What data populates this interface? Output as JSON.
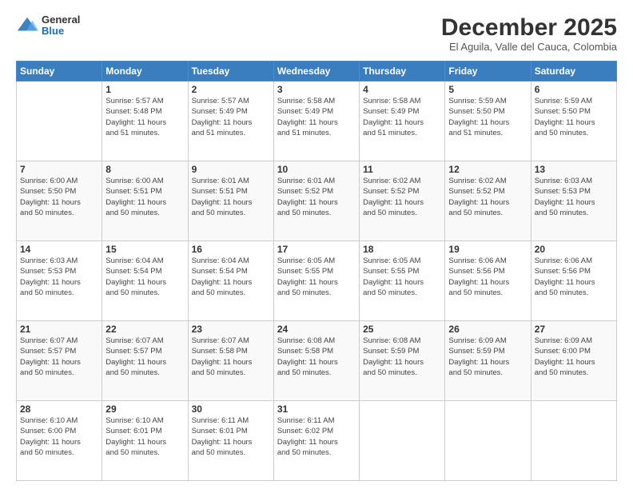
{
  "header": {
    "logo": {
      "general": "General",
      "blue": "Blue"
    },
    "title": "December 2025",
    "subtitle": "El Aguila, Valle del Cauca, Colombia"
  },
  "days_of_week": [
    "Sunday",
    "Monday",
    "Tuesday",
    "Wednesday",
    "Thursday",
    "Friday",
    "Saturday"
  ],
  "weeks": [
    [
      {
        "day": "",
        "info": ""
      },
      {
        "day": "1",
        "info": "Sunrise: 5:57 AM\nSunset: 5:48 PM\nDaylight: 11 hours\nand 51 minutes."
      },
      {
        "day": "2",
        "info": "Sunrise: 5:57 AM\nSunset: 5:49 PM\nDaylight: 11 hours\nand 51 minutes."
      },
      {
        "day": "3",
        "info": "Sunrise: 5:58 AM\nSunset: 5:49 PM\nDaylight: 11 hours\nand 51 minutes."
      },
      {
        "day": "4",
        "info": "Sunrise: 5:58 AM\nSunset: 5:49 PM\nDaylight: 11 hours\nand 51 minutes."
      },
      {
        "day": "5",
        "info": "Sunrise: 5:59 AM\nSunset: 5:50 PM\nDaylight: 11 hours\nand 51 minutes."
      },
      {
        "day": "6",
        "info": "Sunrise: 5:59 AM\nSunset: 5:50 PM\nDaylight: 11 hours\nand 50 minutes."
      }
    ],
    [
      {
        "day": "7",
        "info": "Sunrise: 6:00 AM\nSunset: 5:50 PM\nDaylight: 11 hours\nand 50 minutes."
      },
      {
        "day": "8",
        "info": "Sunrise: 6:00 AM\nSunset: 5:51 PM\nDaylight: 11 hours\nand 50 minutes."
      },
      {
        "day": "9",
        "info": "Sunrise: 6:01 AM\nSunset: 5:51 PM\nDaylight: 11 hours\nand 50 minutes."
      },
      {
        "day": "10",
        "info": "Sunrise: 6:01 AM\nSunset: 5:52 PM\nDaylight: 11 hours\nand 50 minutes."
      },
      {
        "day": "11",
        "info": "Sunrise: 6:02 AM\nSunset: 5:52 PM\nDaylight: 11 hours\nand 50 minutes."
      },
      {
        "day": "12",
        "info": "Sunrise: 6:02 AM\nSunset: 5:52 PM\nDaylight: 11 hours\nand 50 minutes."
      },
      {
        "day": "13",
        "info": "Sunrise: 6:03 AM\nSunset: 5:53 PM\nDaylight: 11 hours\nand 50 minutes."
      }
    ],
    [
      {
        "day": "14",
        "info": "Sunrise: 6:03 AM\nSunset: 5:53 PM\nDaylight: 11 hours\nand 50 minutes."
      },
      {
        "day": "15",
        "info": "Sunrise: 6:04 AM\nSunset: 5:54 PM\nDaylight: 11 hours\nand 50 minutes."
      },
      {
        "day": "16",
        "info": "Sunrise: 6:04 AM\nSunset: 5:54 PM\nDaylight: 11 hours\nand 50 minutes."
      },
      {
        "day": "17",
        "info": "Sunrise: 6:05 AM\nSunset: 5:55 PM\nDaylight: 11 hours\nand 50 minutes."
      },
      {
        "day": "18",
        "info": "Sunrise: 6:05 AM\nSunset: 5:55 PM\nDaylight: 11 hours\nand 50 minutes."
      },
      {
        "day": "19",
        "info": "Sunrise: 6:06 AM\nSunset: 5:56 PM\nDaylight: 11 hours\nand 50 minutes."
      },
      {
        "day": "20",
        "info": "Sunrise: 6:06 AM\nSunset: 5:56 PM\nDaylight: 11 hours\nand 50 minutes."
      }
    ],
    [
      {
        "day": "21",
        "info": "Sunrise: 6:07 AM\nSunset: 5:57 PM\nDaylight: 11 hours\nand 50 minutes."
      },
      {
        "day": "22",
        "info": "Sunrise: 6:07 AM\nSunset: 5:57 PM\nDaylight: 11 hours\nand 50 minutes."
      },
      {
        "day": "23",
        "info": "Sunrise: 6:07 AM\nSunset: 5:58 PM\nDaylight: 11 hours\nand 50 minutes."
      },
      {
        "day": "24",
        "info": "Sunrise: 6:08 AM\nSunset: 5:58 PM\nDaylight: 11 hours\nand 50 minutes."
      },
      {
        "day": "25",
        "info": "Sunrise: 6:08 AM\nSunset: 5:59 PM\nDaylight: 11 hours\nand 50 minutes."
      },
      {
        "day": "26",
        "info": "Sunrise: 6:09 AM\nSunset: 5:59 PM\nDaylight: 11 hours\nand 50 minutes."
      },
      {
        "day": "27",
        "info": "Sunrise: 6:09 AM\nSunset: 6:00 PM\nDaylight: 11 hours\nand 50 minutes."
      }
    ],
    [
      {
        "day": "28",
        "info": "Sunrise: 6:10 AM\nSunset: 6:00 PM\nDaylight: 11 hours\nand 50 minutes."
      },
      {
        "day": "29",
        "info": "Sunrise: 6:10 AM\nSunset: 6:01 PM\nDaylight: 11 hours\nand 50 minutes."
      },
      {
        "day": "30",
        "info": "Sunrise: 6:11 AM\nSunset: 6:01 PM\nDaylight: 11 hours\nand 50 minutes."
      },
      {
        "day": "31",
        "info": "Sunrise: 6:11 AM\nSunset: 6:02 PM\nDaylight: 11 hours\nand 50 minutes."
      },
      {
        "day": "",
        "info": ""
      },
      {
        "day": "",
        "info": ""
      },
      {
        "day": "",
        "info": ""
      }
    ]
  ]
}
